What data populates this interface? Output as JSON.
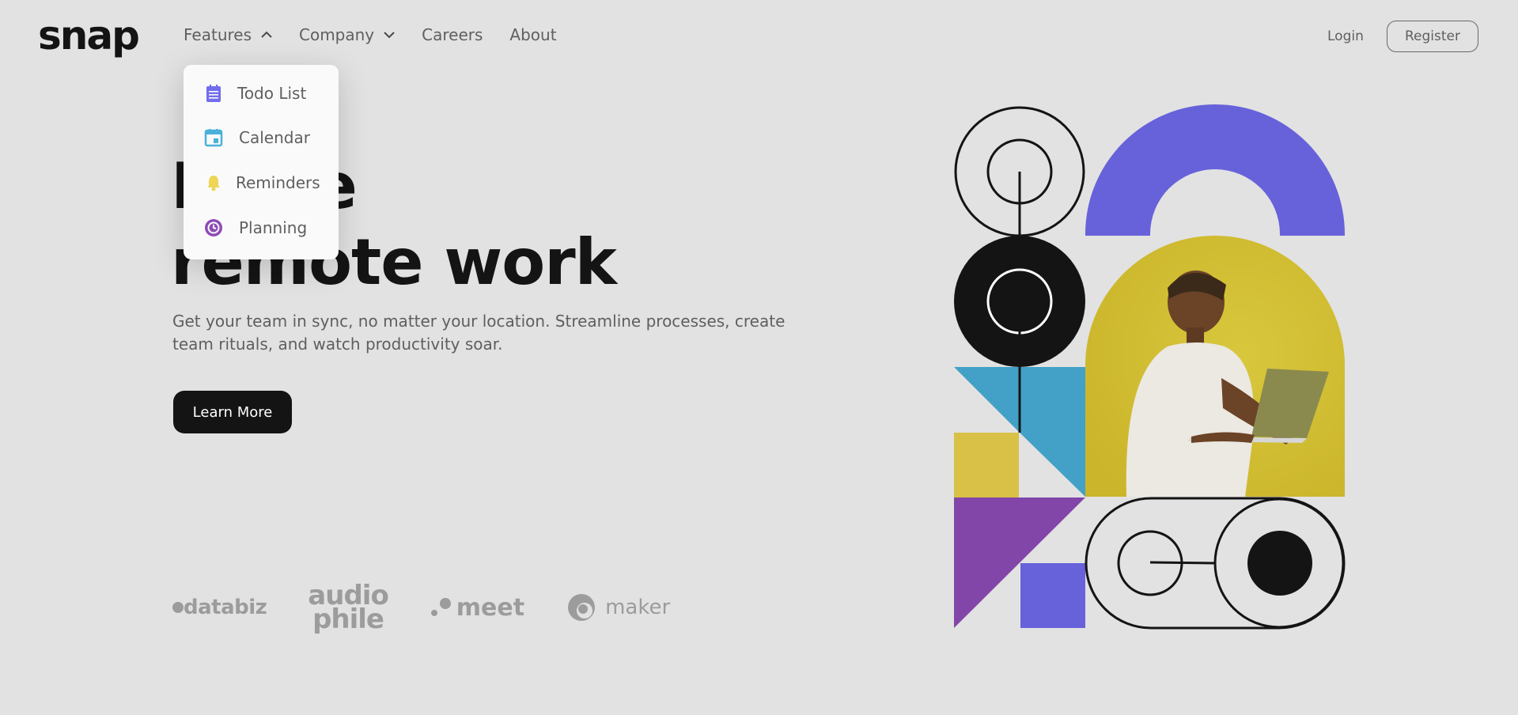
{
  "header": {
    "logo": "snap",
    "nav": [
      {
        "label": "Features",
        "chevron": "up"
      },
      {
        "label": "Company",
        "chevron": "down"
      },
      {
        "label": "Careers"
      },
      {
        "label": "About"
      }
    ],
    "login": "Login",
    "register": "Register"
  },
  "features_menu": [
    {
      "label": "Todo List",
      "icon": "todo-icon",
      "color": "#726CEE"
    },
    {
      "label": "Calendar",
      "icon": "calendar-icon",
      "color": "#4BB1DA"
    },
    {
      "label": "Reminders",
      "icon": "bell-icon",
      "color": "#EDD556"
    },
    {
      "label": "Planning",
      "icon": "planning-icon",
      "color": "#8E4CB6"
    }
  ],
  "hero": {
    "title_line1": "Make",
    "title_line2": "remote work",
    "subtitle": "Get your team in sync, no matter your location. Streamline processes, create team rituals, and watch productivity soar.",
    "cta": "Learn More"
  },
  "clients": [
    "databiz",
    "audio",
    "phile",
    "meet",
    "maker"
  ],
  "colors": {
    "background": "#E2E2E2",
    "text_dark": "#141414",
    "text_gray": "#5F5F5F",
    "purple": "#6762DA",
    "yellow": "#D9C147",
    "blue": "#43A1C7",
    "violet": "#8246A9"
  }
}
